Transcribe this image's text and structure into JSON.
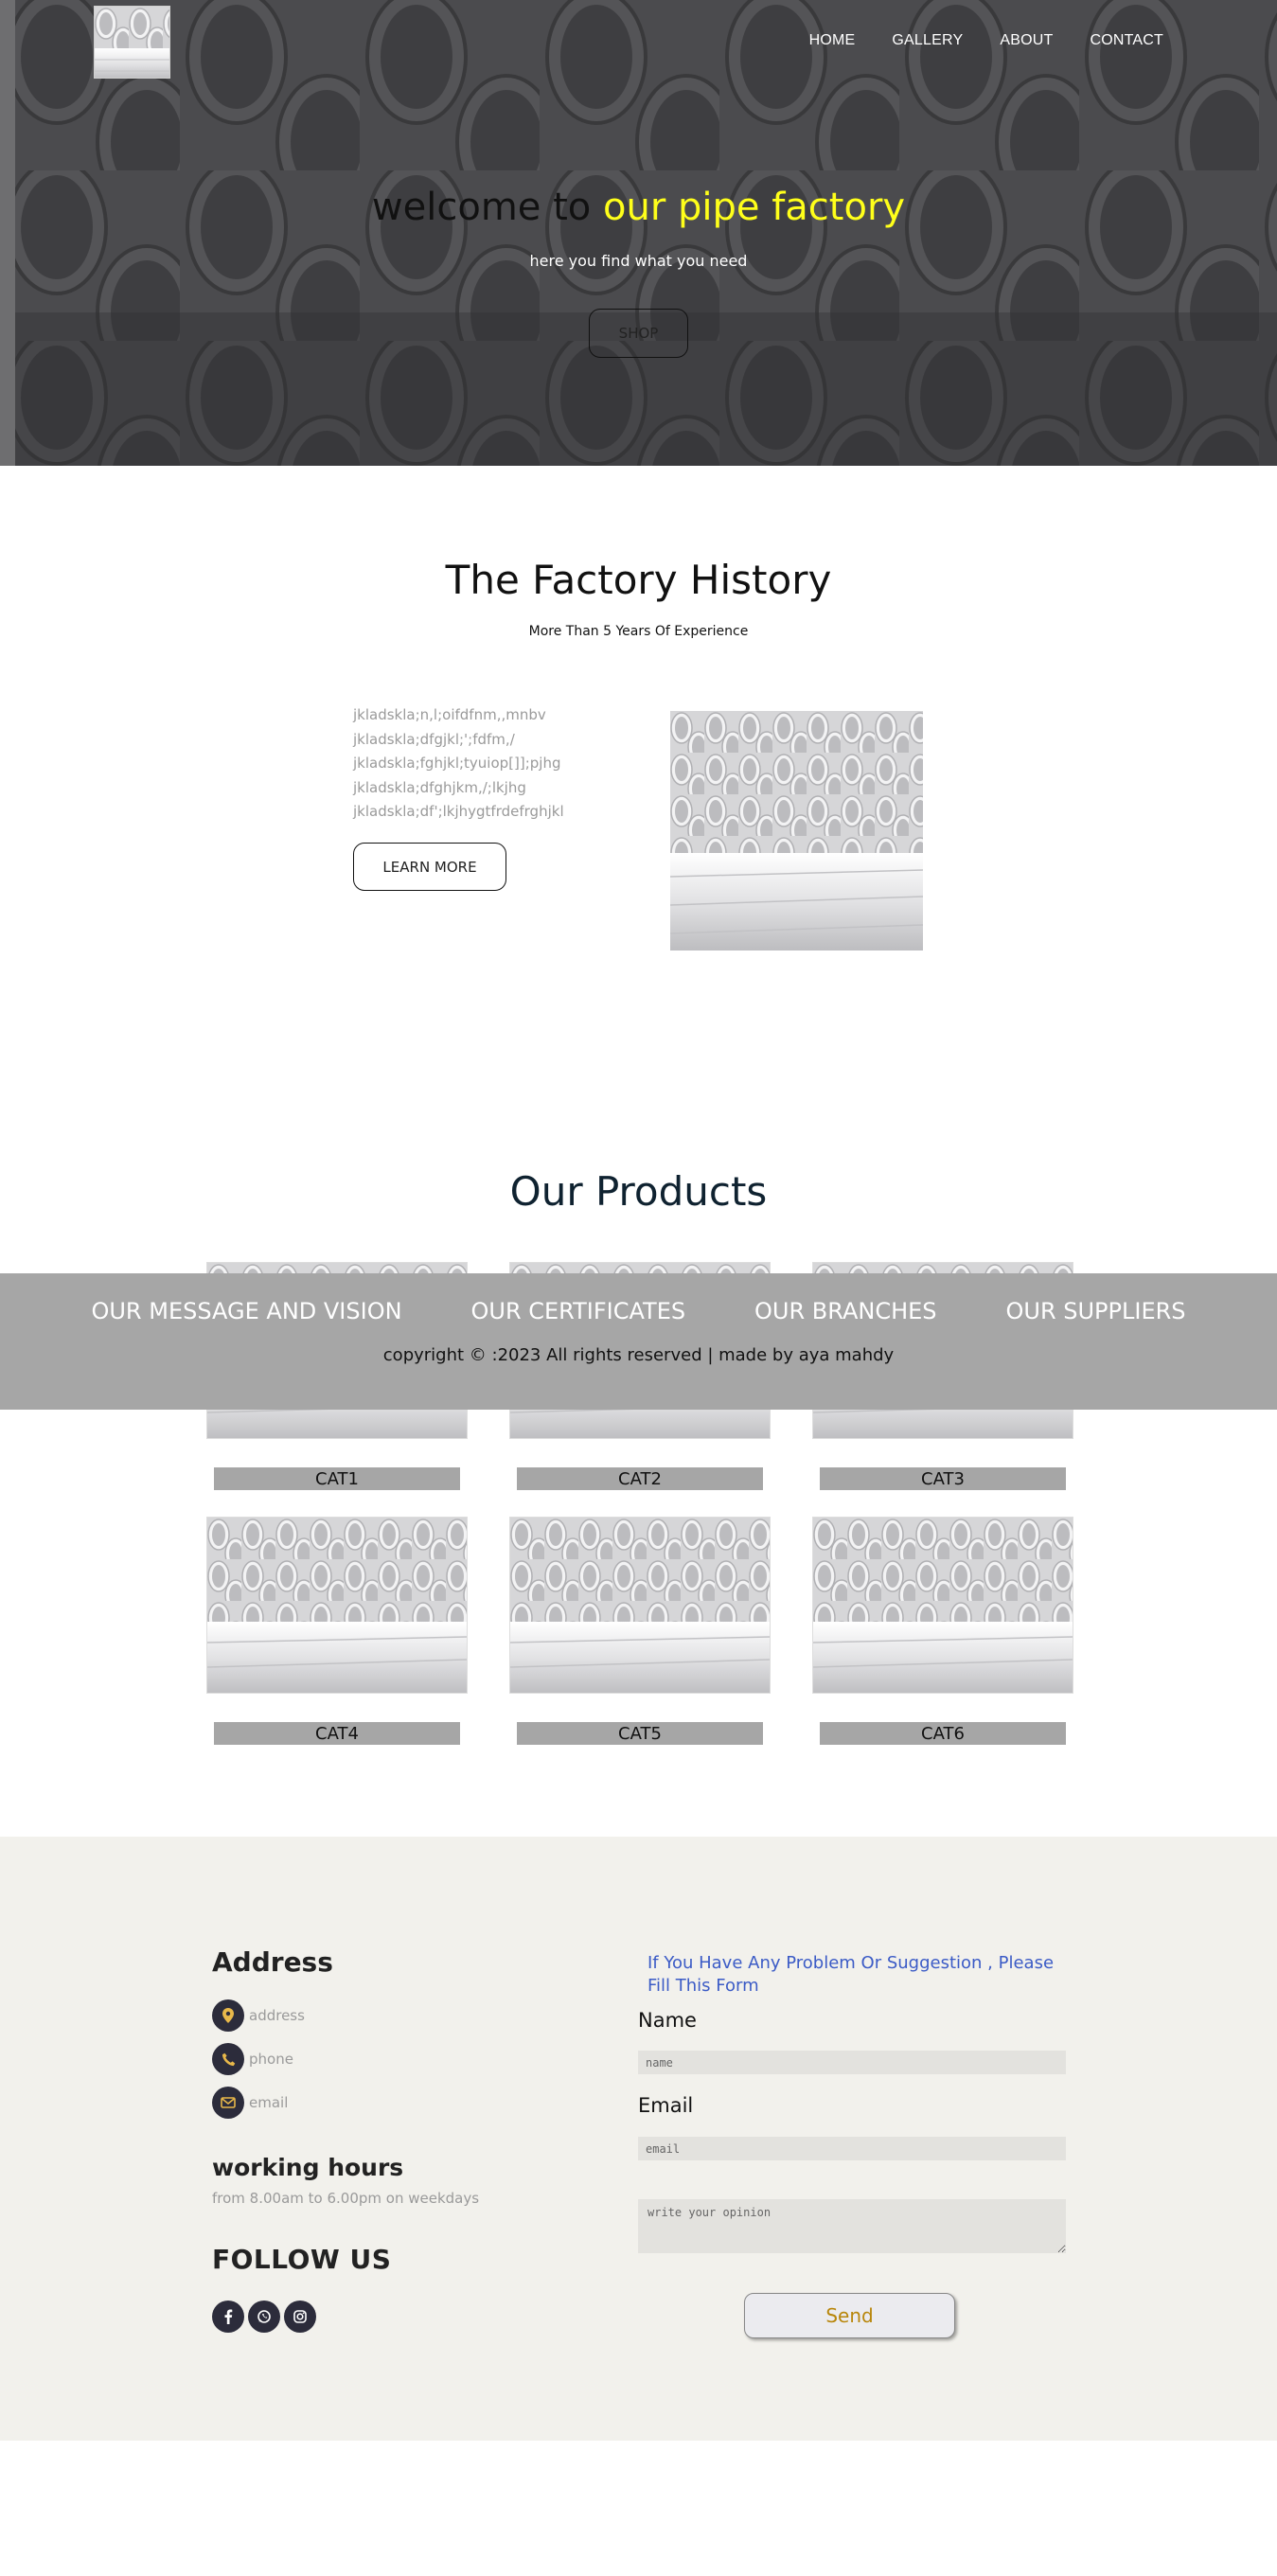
{
  "nav": {
    "home": "HOME",
    "gallery": "GALLERY",
    "about": "ABOUT",
    "contact": "CONTACT"
  },
  "hero": {
    "title_plain": "welcome to",
    "title_accent": "our pipe factory",
    "subtitle": "here you find what you need",
    "shop_button": "SHOP",
    "accent_color": "#ffff1a"
  },
  "history": {
    "title": "The Factory History",
    "subtitle": "More Than 5 Years Of Experience",
    "lines": [
      "jkladskla;n,l;oifdfnm,,mnbv",
      "jkladskla;dfgjkl;';fdfm,/",
      "jkladskla;fghjkl;tyuiop[]];pjhg",
      "jkladskla;dfghjkm,/;lkjhg",
      "jkladskla;df';lkjhygtfrdefrghjkl"
    ],
    "learn_more": "LEARN MORE"
  },
  "products": {
    "title": "Our Products",
    "items": [
      {
        "label": "CAT1"
      },
      {
        "label": "CAT2"
      },
      {
        "label": "CAT3"
      },
      {
        "label": "CAT4"
      },
      {
        "label": "CAT5"
      },
      {
        "label": "CAT6"
      }
    ]
  },
  "footer_bar": {
    "links": [
      "OUR MESSAGE AND VISION",
      "OUR CERTIFICATES",
      "OUR BRANCHES",
      "OUR SUPPLIERS"
    ],
    "copyright": "copyright © :2023 All rights reserved | made by aya mahdy"
  },
  "contact": {
    "address_title": "Address",
    "address": "address",
    "phone": "phone",
    "email": "email",
    "working_hours_title": "working hours",
    "working_hours": "from 8.00am to 6.00pm on weekdays",
    "follow_title": "FOLLOW US",
    "social_icons": [
      "facebook-icon",
      "whatsapp-icon",
      "instagram-icon"
    ],
    "form": {
      "intro": "If You Have Any Problem Or Suggestion , Please Fill This Form",
      "name_label": "Name",
      "name_placeholder": "name",
      "email_label": "Email",
      "email_placeholder": "email",
      "opinion_placeholder": "write your opinion",
      "send_button": "Send"
    }
  }
}
